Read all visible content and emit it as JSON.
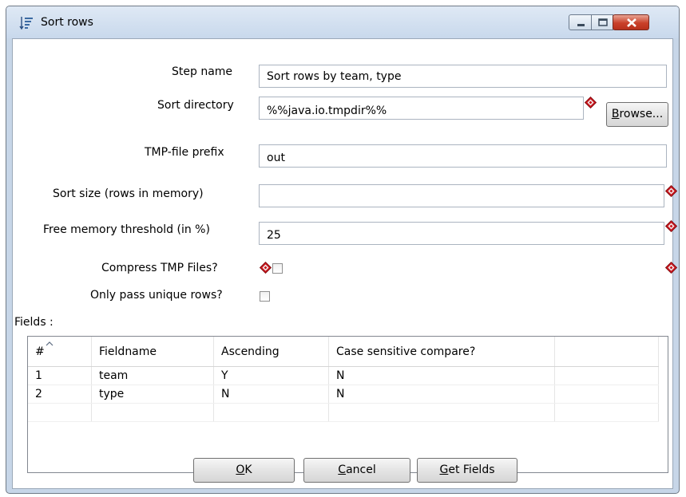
{
  "window": {
    "title": "Sort rows"
  },
  "form": {
    "step_name_label": "Step name",
    "step_name_value": "Sort rows by team, type",
    "sort_directory_label": "Sort directory",
    "sort_directory_value": "%%java.io.tmpdir%%",
    "browse_label_mnemonic": "B",
    "browse_label_rest": "rowse...",
    "tmp_prefix_label": "TMP-file prefix",
    "tmp_prefix_value": "out",
    "sort_size_label": "Sort size (rows in memory)",
    "sort_size_value": "",
    "free_memory_label": "Free memory threshold (in %)",
    "free_memory_value": "25",
    "compress_label": "Compress TMP Files?",
    "compress_checked": false,
    "unique_label": "Only pass unique rows?",
    "unique_checked": false,
    "fields_label": "Fields :"
  },
  "table": {
    "columns": [
      "#",
      "Fieldname",
      "Ascending",
      "Case sensitive compare?"
    ],
    "rows": [
      [
        "1",
        "team",
        "Y",
        "N"
      ],
      [
        "2",
        "type",
        "N",
        "N"
      ]
    ]
  },
  "buttons": {
    "ok_mnemonic": "O",
    "ok_rest": "K",
    "cancel_mnemonic": "C",
    "cancel_rest": "ancel",
    "getfields_mnemonic": "G",
    "getfields_rest": "et Fields"
  },
  "icons": {
    "window": "sort-rows-icon",
    "variable": "variable-diamond-icon"
  },
  "colors": {
    "diamond_red": "#c8161d",
    "title_bg": "#c7d6e8",
    "close_red": "#c9402a"
  }
}
